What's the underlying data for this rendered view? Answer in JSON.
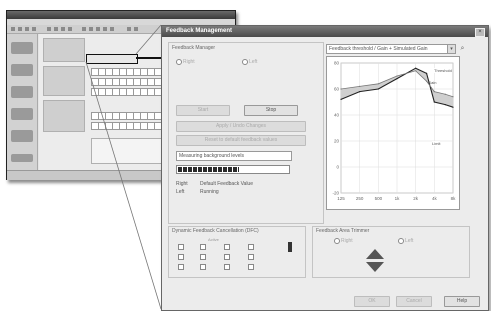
{
  "dialog": {
    "title": "Feedback Management",
    "close_glyph": "×",
    "group_feedback_manager": "Feedback Manager",
    "radio_right": "Right",
    "radio_left": "Left",
    "btn_start": "Start",
    "btn_stop": "Stop",
    "btn_apply": "Apply / Undo Changes",
    "btn_reset": "Reset to default feedback values",
    "status_measuring": "Measuring background levels",
    "progress_fraction": 0.55,
    "result_right_label": "Right",
    "result_right_value": "Default Feedback Value",
    "result_left_label": "Left",
    "result_left_value": "Running",
    "group_dfc": "Dynamic Feedback Cancellation (DFC)",
    "dfc_col": "Active",
    "group_gain_trimmer": "Feedback Area Trimmer",
    "gt_right": "Right",
    "gt_left": "Left",
    "btn_ok": "OK",
    "btn_cancel": "Cancel",
    "btn_help": "Help"
  },
  "graph": {
    "combo_value": "Feedback threshold / Gain + Simulated Gain",
    "legend_1": "Threshold",
    "legend_2": "Gain",
    "legend_3": "Limit",
    "y_ticks": [
      "80",
      "60",
      "40",
      "20",
      "0",
      "-20"
    ],
    "x_ticks": [
      "125",
      "250",
      "500",
      "1k",
      "2k",
      "4k",
      "8k"
    ]
  },
  "chart_data": {
    "type": "line",
    "x": [
      125,
      250,
      500,
      1000,
      2000,
      3000,
      4000,
      6000,
      8000
    ],
    "series": [
      {
        "values": [
          52,
          58,
          60,
          68,
          76,
          72,
          50,
          48,
          46
        ]
      },
      {
        "values": [
          60,
          62,
          64,
          70,
          74,
          66,
          58,
          56,
          54
        ]
      }
    ],
    "ylim": [
      -20,
      80
    ]
  },
  "colors": {
    "titlebar": "#5a5a5a",
    "panel": "#ececec"
  }
}
